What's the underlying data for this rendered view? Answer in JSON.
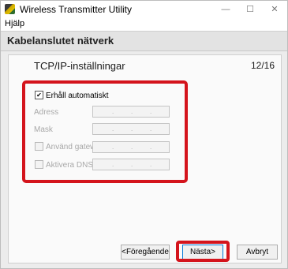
{
  "window": {
    "title": "Wireless Transmitter Utility",
    "controls": {
      "minimize": "—",
      "maximize": "☐",
      "close": "✕"
    }
  },
  "menu": {
    "help": "Hjälp"
  },
  "header": {
    "title": "Kabelanslutet nätverk"
  },
  "page": {
    "title": "TCP/IP-inställningar",
    "counter": "12/16"
  },
  "form": {
    "auto_obtain": {
      "label": "Erhåll automatiskt",
      "checked": true
    },
    "address": {
      "label": "Adress",
      "value": ".   .   ."
    },
    "mask": {
      "label": "Mask",
      "value": ".   .   ."
    },
    "gateway": {
      "label": "Använd gateway",
      "checked": false,
      "value": ".   .   ."
    },
    "dns": {
      "label": "Aktivera DNS",
      "checked": false,
      "value": ".   .   ."
    }
  },
  "buttons": {
    "previous": "<Föregående",
    "next": "Nästa>",
    "cancel": "Avbryt"
  },
  "colors": {
    "highlight": "#d4141c"
  }
}
